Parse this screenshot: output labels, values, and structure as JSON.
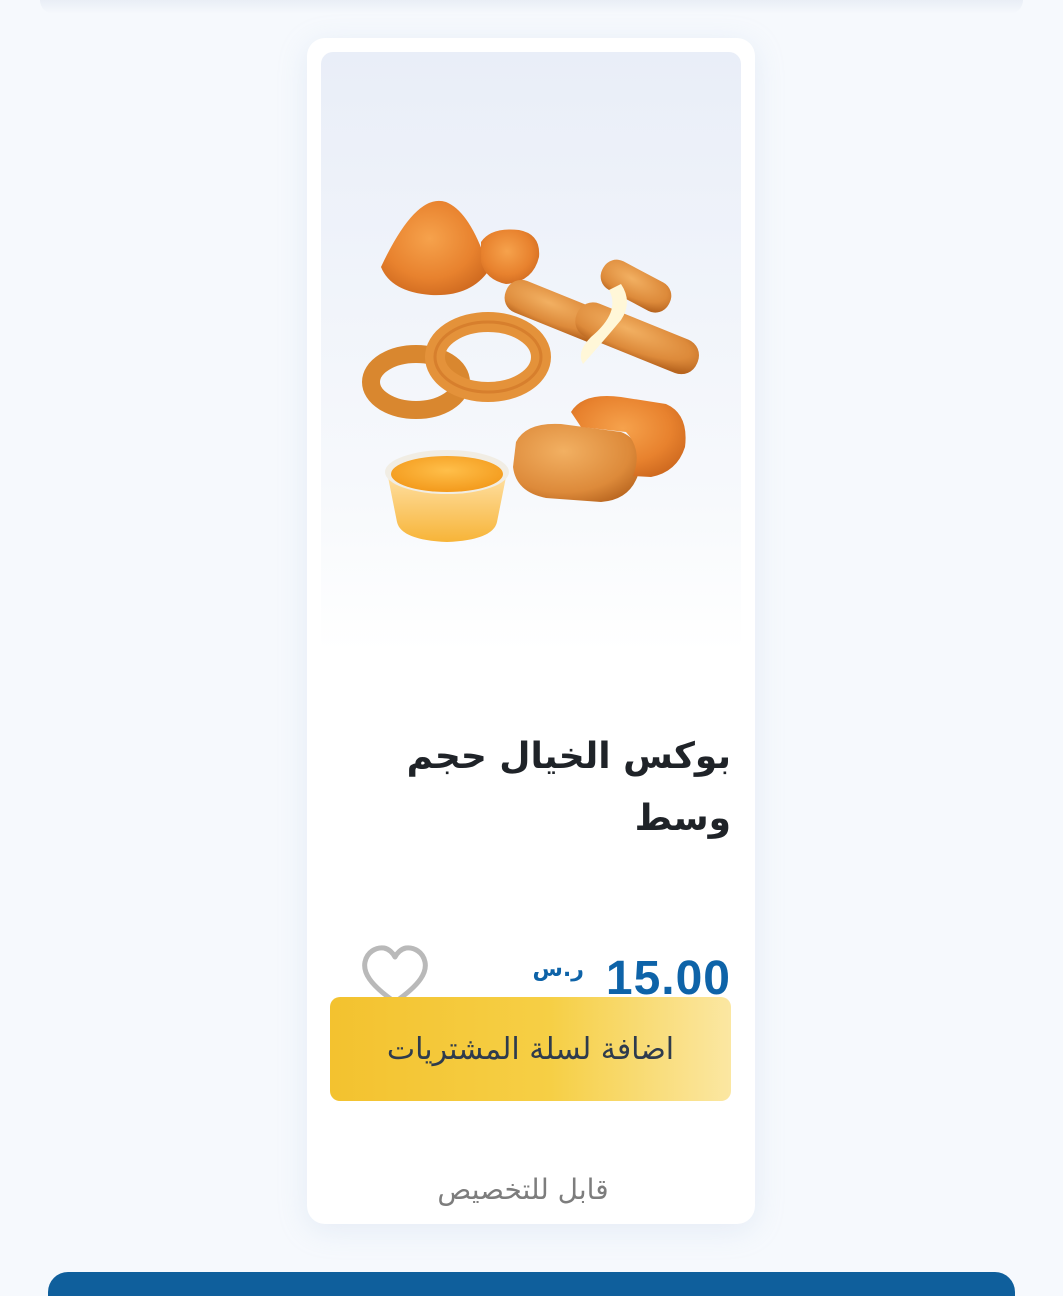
{
  "product": {
    "title": "بوكس الخيال حجم وسط",
    "price": "15.00",
    "currency": "ر.س",
    "add_to_cart_label": "اضافة لسلة المشتريات",
    "customizable_label": "قابل للتخصيص",
    "favorite_icon": "heart-outline-icon",
    "image_description_icon": "product-image"
  },
  "colors": {
    "price": "#0e63a8",
    "button": "#f3c22f",
    "bottom_bar": "#0f5f9c"
  }
}
